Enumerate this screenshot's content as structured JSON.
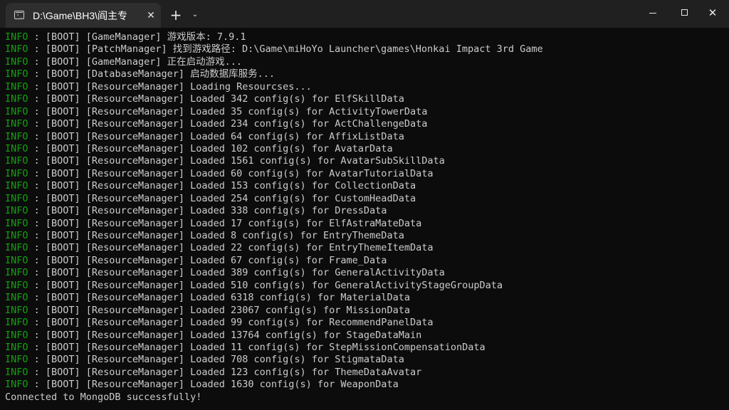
{
  "window": {
    "tab_title": "D:\\Game\\BH3\\阎主专",
    "tab_icon": "terminal-icon",
    "controls": {
      "close_tab": "✕",
      "new_tab": "+",
      "dropdown": "⌄",
      "close_window": "✕"
    }
  },
  "colors": {
    "background": "#0c0c0c",
    "titlebar": "#202020",
    "tab": "#2e2e2e",
    "info_level": "#13a10e",
    "text": "#cccccc"
  },
  "log": [
    {
      "level": "INFO",
      "sep": " : ",
      "text": "[BOOT] [GameManager] 游戏版本: 7.9.1"
    },
    {
      "level": "INFO",
      "sep": " : ",
      "text": "[BOOT] [PatchManager] 找到游戏路径: D:\\Game\\miHoYo Launcher\\games\\Honkai Impact 3rd Game"
    },
    {
      "level": "INFO",
      "sep": " : ",
      "text": "[BOOT] [GameManager] 正在启动游戏..."
    },
    {
      "level": "INFO",
      "sep": " : ",
      "text": "[BOOT] [DatabaseManager] 启动数据库服务..."
    },
    {
      "level": "INFO",
      "sep": " : ",
      "text": "[BOOT] [ResourceManager] Loading Resourcses..."
    },
    {
      "level": "INFO",
      "sep": " : ",
      "text": "[BOOT] [ResourceManager] Loaded 342 config(s) for ElfSkillData"
    },
    {
      "level": "INFO",
      "sep": " : ",
      "text": "[BOOT] [ResourceManager] Loaded 35 config(s) for ActivityTowerData"
    },
    {
      "level": "INFO",
      "sep": " : ",
      "text": "[BOOT] [ResourceManager] Loaded 234 config(s) for ActChallengeData"
    },
    {
      "level": "INFO",
      "sep": " : ",
      "text": "[BOOT] [ResourceManager] Loaded 64 config(s) for AffixListData"
    },
    {
      "level": "INFO",
      "sep": " : ",
      "text": "[BOOT] [ResourceManager] Loaded 102 config(s) for AvatarData"
    },
    {
      "level": "INFO",
      "sep": " : ",
      "text": "[BOOT] [ResourceManager] Loaded 1561 config(s) for AvatarSubSkillData"
    },
    {
      "level": "INFO",
      "sep": " : ",
      "text": "[BOOT] [ResourceManager] Loaded 60 config(s) for AvatarTutorialData"
    },
    {
      "level": "INFO",
      "sep": " : ",
      "text": "[BOOT] [ResourceManager] Loaded 153 config(s) for CollectionData"
    },
    {
      "level": "INFO",
      "sep": " : ",
      "text": "[BOOT] [ResourceManager] Loaded 254 config(s) for CustomHeadData"
    },
    {
      "level": "INFO",
      "sep": " : ",
      "text": "[BOOT] [ResourceManager] Loaded 338 config(s) for DressData"
    },
    {
      "level": "INFO",
      "sep": " : ",
      "text": "[BOOT] [ResourceManager] Loaded 17 config(s) for ElfAstraMateData"
    },
    {
      "level": "INFO",
      "sep": " : ",
      "text": "[BOOT] [ResourceManager] Loaded 8 config(s) for EntryThemeData"
    },
    {
      "level": "INFO",
      "sep": " : ",
      "text": "[BOOT] [ResourceManager] Loaded 22 config(s) for EntryThemeItemData"
    },
    {
      "level": "INFO",
      "sep": " : ",
      "text": "[BOOT] [ResourceManager] Loaded 67 config(s) for Frame_Data"
    },
    {
      "level": "INFO",
      "sep": " : ",
      "text": "[BOOT] [ResourceManager] Loaded 389 config(s) for GeneralActivityData"
    },
    {
      "level": "INFO",
      "sep": " : ",
      "text": "[BOOT] [ResourceManager] Loaded 510 config(s) for GeneralActivityStageGroupData"
    },
    {
      "level": "INFO",
      "sep": " : ",
      "text": "[BOOT] [ResourceManager] Loaded 6318 config(s) for MaterialData"
    },
    {
      "level": "INFO",
      "sep": " : ",
      "text": "[BOOT] [ResourceManager] Loaded 23067 config(s) for MissionData"
    },
    {
      "level": "INFO",
      "sep": " : ",
      "text": "[BOOT] [ResourceManager] Loaded 99 config(s) for RecommendPanelData"
    },
    {
      "level": "INFO",
      "sep": " : ",
      "text": "[BOOT] [ResourceManager] Loaded 13764 config(s) for StageDataMain"
    },
    {
      "level": "INFO",
      "sep": " : ",
      "text": "[BOOT] [ResourceManager] Loaded 11 config(s) for StepMissionCompensationData"
    },
    {
      "level": "INFO",
      "sep": " : ",
      "text": "[BOOT] [ResourceManager] Loaded 708 config(s) for StigmataData"
    },
    {
      "level": "INFO",
      "sep": " : ",
      "text": "[BOOT] [ResourceManager] Loaded 123 config(s) for ThemeDataAvatar"
    },
    {
      "level": "INFO",
      "sep": " : ",
      "text": "[BOOT] [ResourceManager] Loaded 1630 config(s) for WeaponData"
    },
    {
      "level": "",
      "sep": "",
      "text": "Connected to MongoDB successfully!"
    }
  ]
}
